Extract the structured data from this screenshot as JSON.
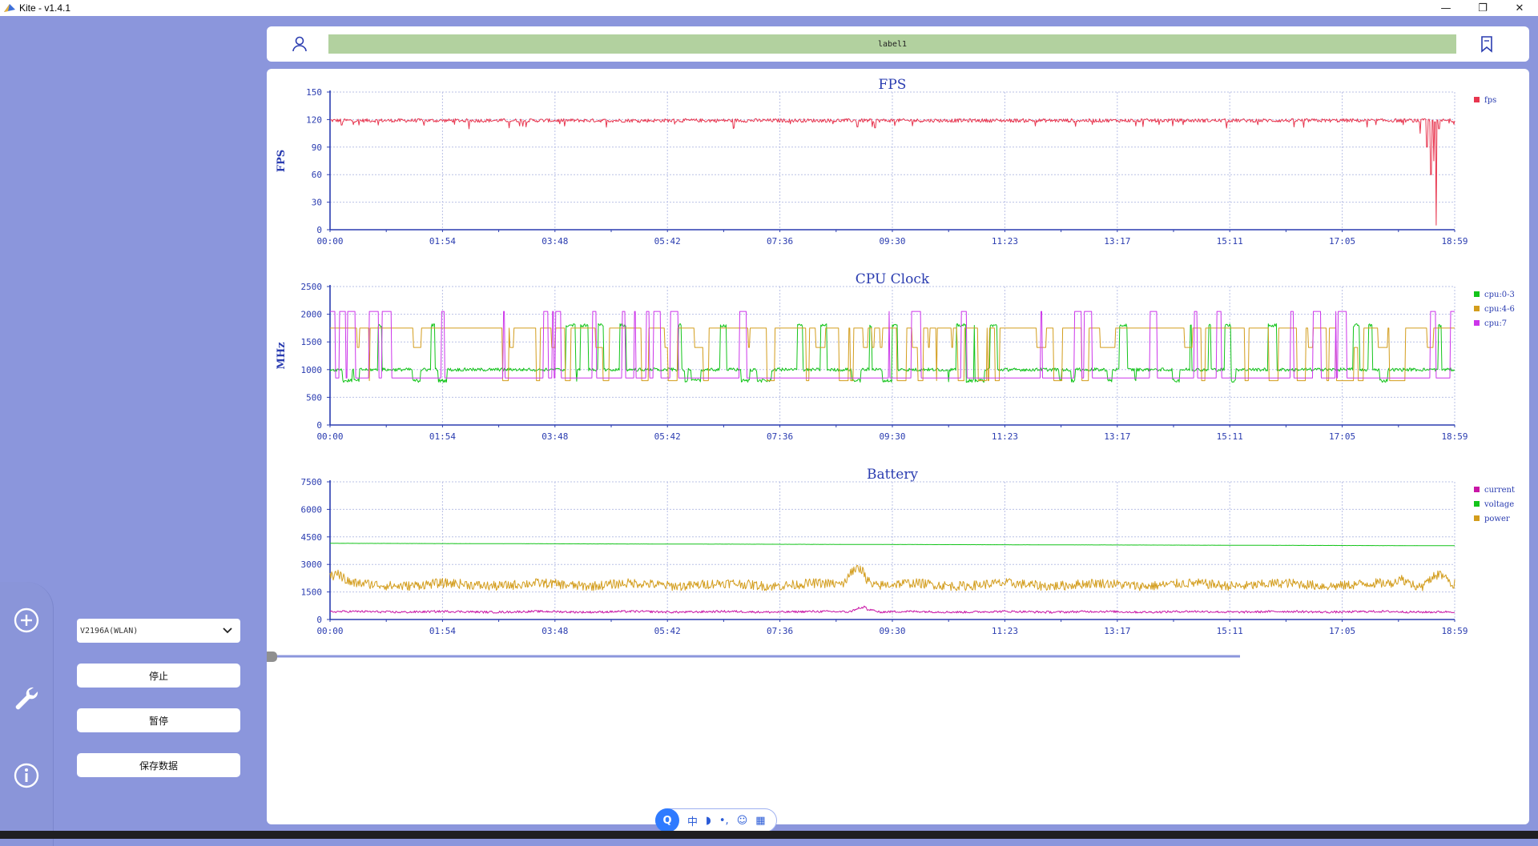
{
  "window": {
    "title": "Kite - v1.4.1",
    "minimize": "—",
    "restore": "❐",
    "close": "✕"
  },
  "colors": {
    "accent": "#8b96dc",
    "label_bar": "#b2d19f",
    "axis": "#2a3cb0",
    "fps": "#e8364f",
    "cpu0_3": "#13c41a",
    "cpu4_6": "#d39d1d",
    "cpu7": "#cc35ea",
    "current": "#c916a6",
    "voltage": "#13c41a",
    "power": "#d39d1d"
  },
  "header": {
    "label": "label1",
    "user_icon": "user-icon",
    "bookmark_icon": "bookmark-icon"
  },
  "sidebar": {
    "icons": [
      "plus-circle-icon",
      "wrench-icon",
      "info-icon"
    ],
    "device": "V2196A(WLAN)",
    "buttons": {
      "stop": "停止",
      "pause": "暂停",
      "save": "保存数据"
    }
  },
  "ime": {
    "logo": "Q",
    "lang": "中",
    "items": [
      "◗",
      "•,",
      "☺",
      "▦"
    ]
  },
  "chart_data": [
    {
      "type": "line",
      "title": "FPS",
      "ylabel": "FPS",
      "x_ticks": [
        "00:00",
        "01:54",
        "03:48",
        "05:42",
        "07:36",
        "09:30",
        "11:23",
        "13:17",
        "15:11",
        "17:05",
        "18:59"
      ],
      "xlim": [
        "00:00",
        "18:59"
      ],
      "ylim": [
        0,
        150
      ],
      "y_ticks": [
        0,
        30,
        60,
        90,
        120,
        150
      ],
      "grid": true,
      "legend": "top-right",
      "series": [
        {
          "name": "fps",
          "color": "#e8364f",
          "baseline": 119,
          "noise": 2,
          "dips": [
            [
              0.2,
              114
            ],
            [
              3.2,
              113
            ],
            [
              8.9,
              112
            ],
            [
              9.2,
              111
            ],
            [
              13.6,
              113
            ],
            [
              18.4,
              105
            ],
            [
              18.52,
              90
            ],
            [
              18.58,
              60
            ],
            [
              18.63,
              75
            ],
            [
              18.67,
              5
            ],
            [
              18.72,
              110
            ]
          ]
        }
      ]
    },
    {
      "type": "line",
      "title": "CPU Clock",
      "ylabel": "MHz",
      "x_ticks": [
        "00:00",
        "01:54",
        "03:48",
        "05:42",
        "07:36",
        "09:30",
        "11:23",
        "13:17",
        "15:11",
        "17:05",
        "18:59"
      ],
      "xlim": [
        "00:00",
        "18:59"
      ],
      "ylim": [
        0,
        2500
      ],
      "y_ticks": [
        0,
        500,
        1000,
        1500,
        2000,
        2500
      ],
      "grid": true,
      "legend": "top-right",
      "series": [
        {
          "name": "cpu:0-3",
          "color": "#13c41a",
          "levels": [
            800,
            1000,
            1800
          ],
          "dominant": 1000
        },
        {
          "name": "cpu:4-6",
          "color": "#d39d1d",
          "levels": [
            800,
            1400,
            1750
          ],
          "dominant": 1750
        },
        {
          "name": "cpu:7",
          "color": "#cc35ea",
          "levels": [
            850,
            2050
          ],
          "dominant": 850
        }
      ]
    },
    {
      "type": "line",
      "title": "Battery",
      "ylabel": "",
      "x_ticks": [
        "00:00",
        "01:54",
        "03:48",
        "05:42",
        "07:36",
        "09:30",
        "11:23",
        "13:17",
        "15:11",
        "17:05",
        "18:59"
      ],
      "xlim": [
        "00:00",
        "18:59"
      ],
      "ylim": [
        0,
        7500
      ],
      "y_ticks": [
        0,
        1500,
        3000,
        4500,
        6000,
        7500
      ],
      "grid": true,
      "legend": "top-right",
      "series": [
        {
          "name": "current",
          "color": "#c916a6",
          "baseline": 420,
          "noise": 60,
          "bumps": [
            [
              9.0,
              750
            ]
          ]
        },
        {
          "name": "voltage",
          "color": "#13c41a",
          "start": 4150,
          "end": 4020
        },
        {
          "name": "power",
          "color": "#d39d1d",
          "baseline": 1900,
          "noise": 260,
          "bumps": [
            [
              0.1,
              2700
            ],
            [
              8.9,
              3300
            ],
            [
              18.1,
              2300
            ],
            [
              18.7,
              2800
            ]
          ]
        }
      ]
    }
  ]
}
